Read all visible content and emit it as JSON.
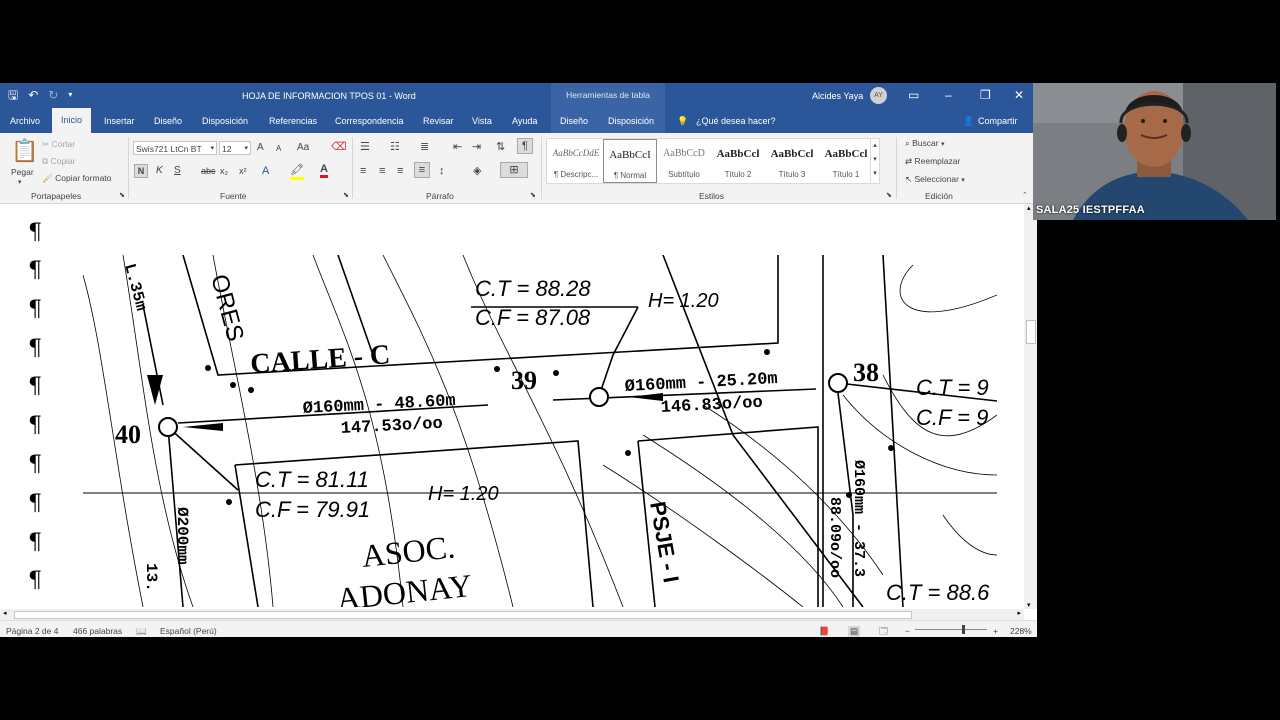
{
  "window": {
    "doc_title": "HOJA DE INFORMACION TPOS 01  -  Word",
    "context_group": "Herramientas de tabla",
    "user_name": "Alcides Yaya",
    "user_initials": "AY"
  },
  "tabs": [
    "Archivo",
    "Inicio",
    "Insertar",
    "Diseño",
    "Disposición",
    "Referencias",
    "Correspondencia",
    "Revisar",
    "Vista",
    "Ayuda",
    "Diseño",
    "Disposición"
  ],
  "tell_me": "¿Qué desea hacer?",
  "share": "Compartir",
  "clipboard": {
    "paste": "Pegar",
    "cut": "Cortar",
    "copy": "Copiar",
    "format_painter": "Copiar formato",
    "label": "Portapapeles"
  },
  "font": {
    "name": "Swis721 LtCn BT",
    "size": "12",
    "label": "Fuente",
    "bold": "N",
    "italic": "K",
    "underline": "S",
    "strike": "abc",
    "sub": "x₂",
    "sup": "x²",
    "grow": "A",
    "shrink": "A",
    "case": "Aa",
    "effects": "A",
    "color": "A"
  },
  "paragraph": {
    "label": "Párrafo"
  },
  "styles": {
    "label": "Estilos",
    "items": [
      {
        "preview": "AaBbCcDdE",
        "name": "¶ Descripc..."
      },
      {
        "preview": "AaBbCcI",
        "name": "¶ Normal"
      },
      {
        "preview": "AaBbCcD",
        "name": "Subtítulo"
      },
      {
        "preview": "AaBbCcl",
        "name": "Título 2"
      },
      {
        "preview": "AaBbCcl",
        "name": "Título 3"
      },
      {
        "preview": "AaBbCcl",
        "name": "Título 1"
      }
    ]
  },
  "editing": {
    "label": "Edición",
    "find": "Buscar",
    "replace": "Reemplazar",
    "select": "Seleccionar"
  },
  "document": {
    "pilcrow": "¶",
    "map_labels": {
      "ct1": "C.T = 88.28",
      "cf1": "C.F = 87.08",
      "h1": "H= 1.20",
      "ores": "ORES",
      "calle": "CALLE - C",
      "pipe1": "Ø160mm - 48.60m",
      "slope1": "147.53o/oo",
      "n39": "39",
      "pipe2": "Ø160mm - 25.20m",
      "slope2": "146.83o/oo",
      "n38": "38",
      "ct_right": "C.T = 9",
      "cf_right": "C.F = 9",
      "n40": "40",
      "ct2": "C.T = 81.11",
      "cf2": "C.F = 79.91",
      "h2": "H= 1.20",
      "asoc": "ASOC.",
      "adonay": "ADONAY",
      "psje": "PSJE - I",
      "pipe3": "Ø160mm - 37.3",
      "slope3": "88.09o/oo",
      "pipe4": "Ø200mm",
      "len4": "13.",
      "m35": "L.35m",
      "ct3": "C.T = 88.6"
    }
  },
  "status": {
    "page": "Página 2 de 4",
    "words": "466 palabras",
    "language": "Español (Perú)",
    "zoom": "228%"
  },
  "video": {
    "participant": "SALA25 IESTPFFAA"
  }
}
